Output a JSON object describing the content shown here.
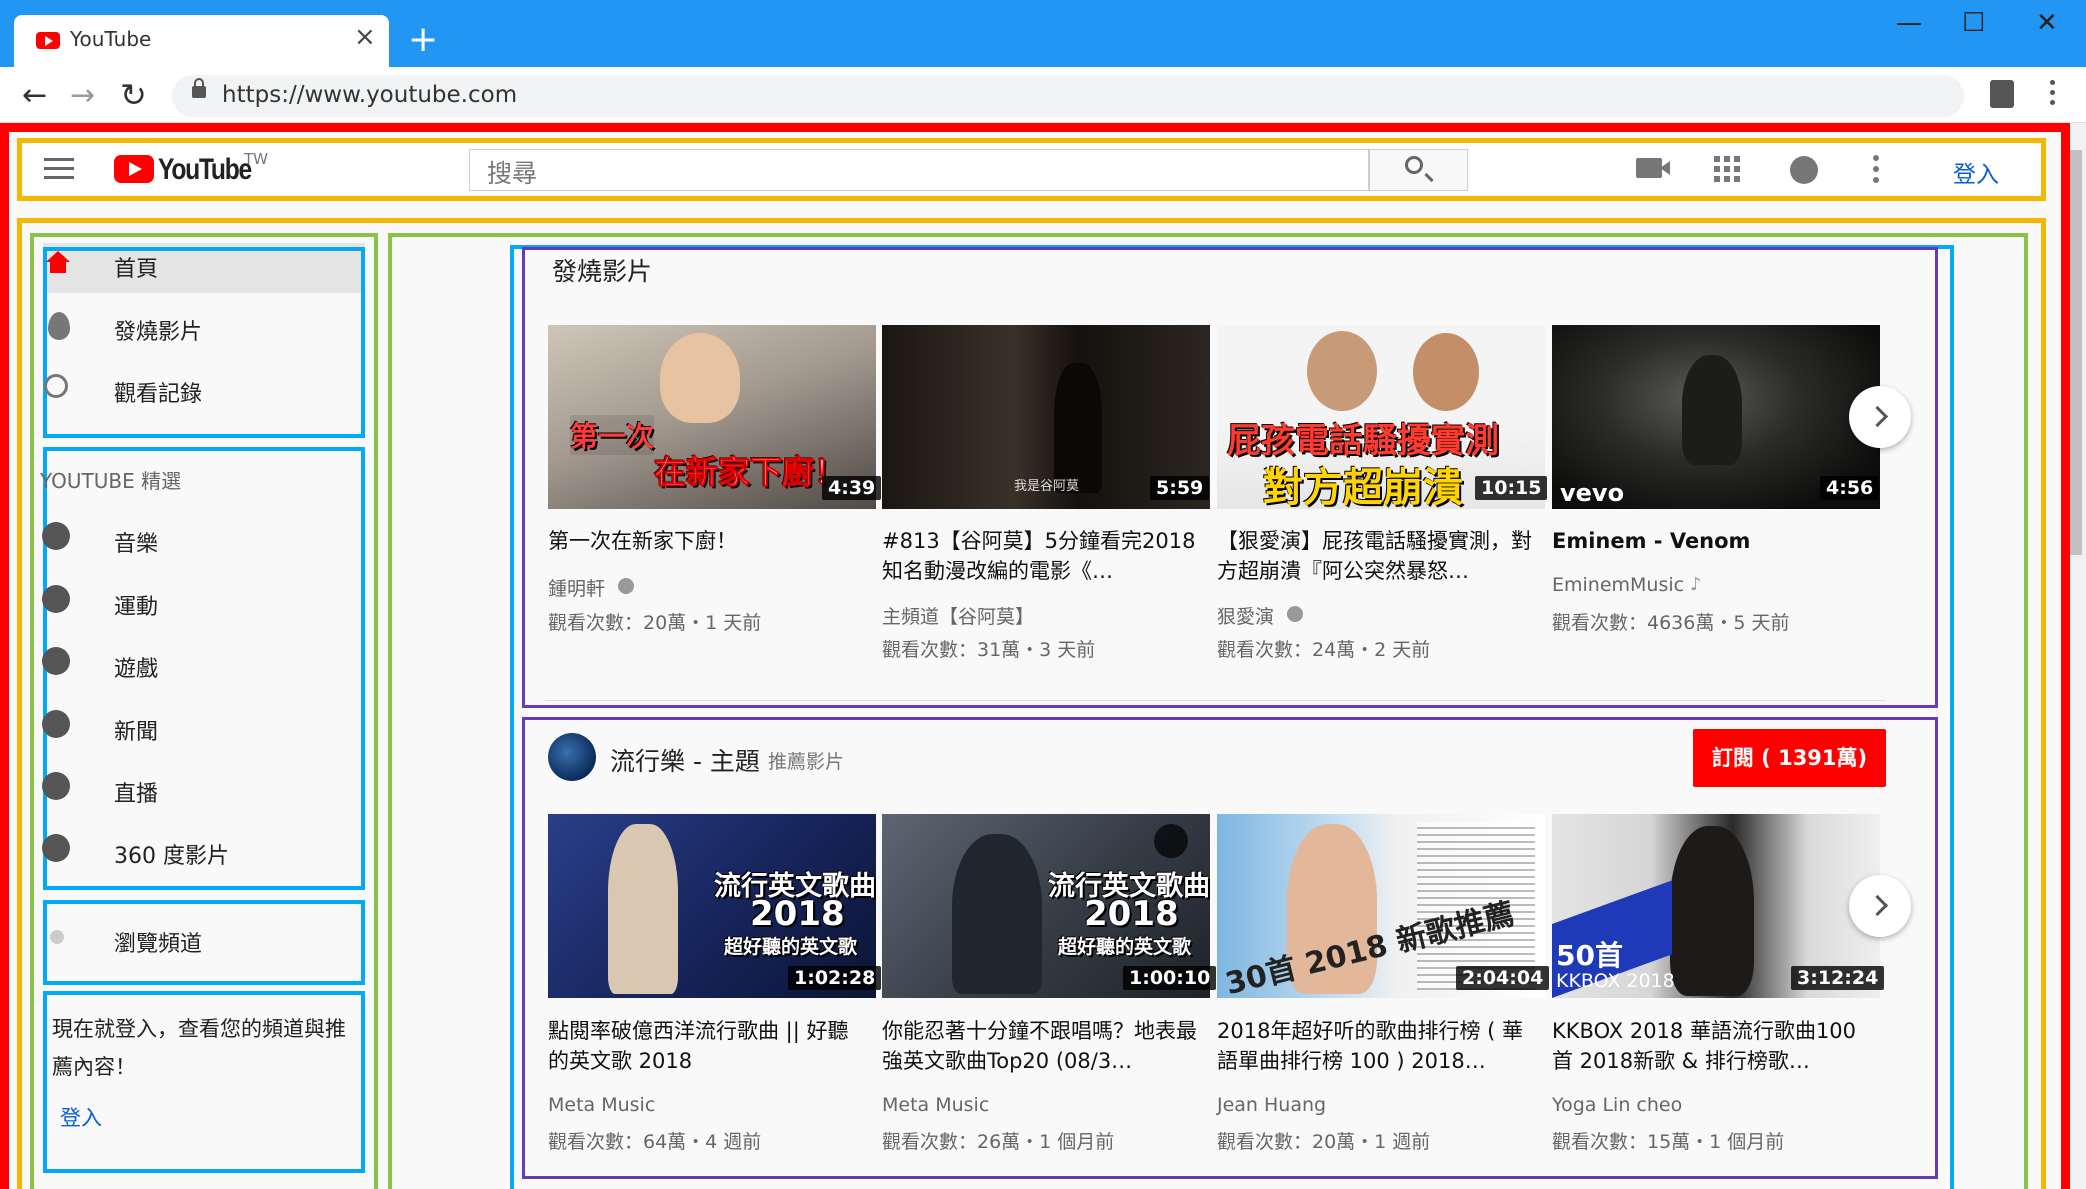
{
  "browser": {
    "tab_title": "YouTube",
    "tab_close": "×",
    "new_tab": "+",
    "url": "https://www.youtube.com",
    "win_min": "—",
    "win_max": "☐",
    "win_close": "✕"
  },
  "masthead": {
    "logo_text": "YouTube",
    "region": "TW",
    "search_placeholder": "搜尋",
    "signin": "登入"
  },
  "sidebar": {
    "main_items": [
      {
        "label": "首頁",
        "icon": "home-icon"
      },
      {
        "label": "發燒影片",
        "icon": "fire-icon"
      },
      {
        "label": "觀看記錄",
        "icon": "history-icon"
      }
    ],
    "best_heading": "YOUTUBE 精選",
    "best_items": [
      {
        "label": "音樂",
        "icon": "music-icon"
      },
      {
        "label": "運動",
        "icon": "sports-icon"
      },
      {
        "label": "遊戲",
        "icon": "gaming-icon"
      },
      {
        "label": "新聞",
        "icon": "news-icon"
      },
      {
        "label": "直播",
        "icon": "live-icon"
      },
      {
        "label": "360 度影片",
        "icon": "360-icon"
      }
    ],
    "browse_channels": "瀏覽頻道",
    "signin_prompt": "現在就登入，查看您的頻道與推薦內容！",
    "signin_link": "登入"
  },
  "trending": {
    "title": "發燒影片",
    "videos": [
      {
        "title": "第一次在新家下廚！",
        "channel": "鍾明軒",
        "verified": true,
        "meta": "觀看次數：20萬・1 天前",
        "duration": "4:39",
        "overlay1": "第一次",
        "overlay2": "在新家下廚！"
      },
      {
        "title": "#813【谷阿莫】5分鐘看完2018知名動漫改編的電影《…",
        "channel": "主頻道【谷阿莫】",
        "verified": false,
        "meta": "觀看次數：31萬・3 天前",
        "duration": "5:59",
        "overlay1": "我是谷阿莫"
      },
      {
        "title": "【狠愛演】屁孩電話騷擾實測，對方超崩潰『阿公突然暴怒…",
        "channel": "狠愛演",
        "verified": true,
        "meta": "觀看次數：24萬・2 天前",
        "duration": "10:15",
        "overlay1": "屁孩電話騷擾實測",
        "overlay2": "對方超崩潰"
      },
      {
        "title": "Eminem - Venom",
        "channel": "EminemMusic",
        "verified": false,
        "meta": "觀看次數：4636萬・5 天前",
        "duration": "4:56",
        "overlay1": "vevo"
      }
    ]
  },
  "popular": {
    "title": "流行樂 - 主題",
    "subtitle": "推薦影片",
    "subscribe": "訂閱 ( 1391萬)",
    "videos": [
      {
        "title": "點閱率破億西洋流行歌曲 || 好聽的英文歌 2018",
        "channel": "Meta Music",
        "meta": "觀看次數：64萬・4 週前",
        "duration": "1:02:28",
        "overlay1": "流行英文歌曲",
        "overlay2": "2018",
        "overlay3": "超好聽的英文歌"
      },
      {
        "title": "你能忍著十分鐘不跟唱嗎？地表最強英文歌曲Top20 (08/3…",
        "channel": "Meta Music",
        "meta": "觀看次數：26萬・1 個月前",
        "duration": "1:00:10",
        "overlay1": "流行英文歌曲",
        "overlay2": "2018",
        "overlay3": "超好聽的英文歌"
      },
      {
        "title": "2018年超好听的歌曲排行榜 ( 華語單曲排行榜 100 ) 2018…",
        "channel": "Jean Huang",
        "meta": "觀看次數：20萬・1 週前",
        "duration": "2:04:04",
        "overlay1": "30首 2018 新歌推薦"
      },
      {
        "title": "KKBOX 2018 華語流行歌曲100首 2018新歌 & 排行榜歌…",
        "channel": "Yoga Lin cheo",
        "meta": "觀看次數：15萬・1 個月前",
        "duration": "3:12:24",
        "overlay1": "50首",
        "overlay2": "KKBOX 2018"
      }
    ]
  },
  "colors": {
    "brand_red": "#ff0000",
    "link_blue": "#065fd4",
    "chrome_blue": "#2196f3"
  }
}
